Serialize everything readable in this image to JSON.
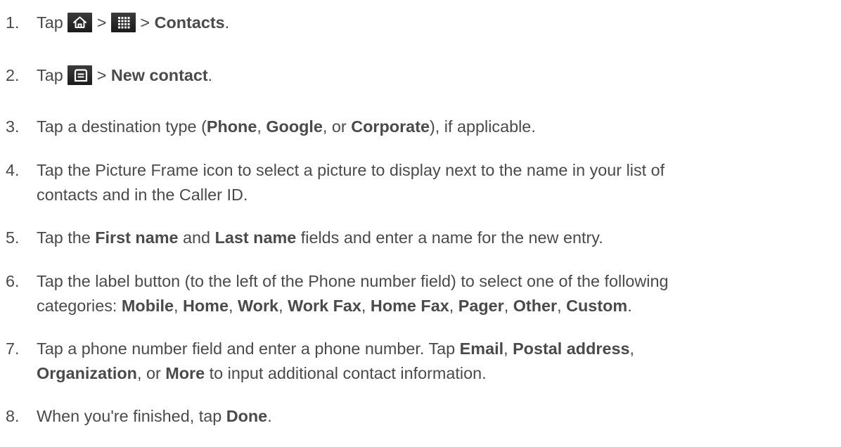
{
  "steps": [
    {
      "number": "1.",
      "parts": [
        {
          "t": "Tap "
        },
        {
          "icon": "home-icon"
        },
        {
          "t": " > "
        },
        {
          "icon": "apps-grid-icon"
        },
        {
          "t": " > "
        },
        {
          "b": "Contacts"
        },
        {
          "t": "."
        }
      ]
    },
    {
      "number": "2.",
      "parts": [
        {
          "t": "Tap "
        },
        {
          "icon": "menu-icon"
        },
        {
          "t": " > "
        },
        {
          "b": "New contact"
        },
        {
          "t": "."
        }
      ]
    },
    {
      "number": "3.",
      "parts": [
        {
          "t": "Tap a destination type ("
        },
        {
          "b": "Phone"
        },
        {
          "t": ", "
        },
        {
          "b": "Google"
        },
        {
          "t": ", or "
        },
        {
          "b": "Corporate"
        },
        {
          "t": "), if applicable."
        }
      ]
    },
    {
      "number": "4.",
      "lines": [
        [
          {
            "t": "Tap the Picture Frame icon to select a picture to display next to the name in your list of"
          }
        ],
        [
          {
            "t": "contacts and in the Caller ID."
          }
        ]
      ]
    },
    {
      "number": "5.",
      "parts": [
        {
          "t": "Tap the "
        },
        {
          "b": "First name"
        },
        {
          "t": " and "
        },
        {
          "b": "Last name"
        },
        {
          "t": " fields and enter a name for the new entry."
        }
      ]
    },
    {
      "number": "6.",
      "lines": [
        [
          {
            "t": "Tap the label button (to the left of the Phone number field) to select one of the following"
          }
        ],
        [
          {
            "t": "categories: "
          },
          {
            "b": "Mobile"
          },
          {
            "t": ", "
          },
          {
            "b": "Home"
          },
          {
            "t": ", "
          },
          {
            "b": "Work"
          },
          {
            "t": ", "
          },
          {
            "b": "Work Fax"
          },
          {
            "t": ", "
          },
          {
            "b": "Home Fax"
          },
          {
            "t": ", "
          },
          {
            "b": "Pager"
          },
          {
            "t": ", "
          },
          {
            "b": "Other"
          },
          {
            "t": ", "
          },
          {
            "b": "Custom"
          },
          {
            "t": "."
          }
        ]
      ]
    },
    {
      "number": "7.",
      "lines": [
        [
          {
            "t": "Tap a phone number field and enter a phone number. Tap "
          },
          {
            "b": "Email"
          },
          {
            "t": ", "
          },
          {
            "b": "Postal address"
          },
          {
            "t": ","
          }
        ],
        [
          {
            "b": "Organization"
          },
          {
            "t": ", or "
          },
          {
            "b": "More"
          },
          {
            "t": " to input additional contact information."
          }
        ]
      ]
    },
    {
      "number": "8.",
      "parts": [
        {
          "t": "When you're finished, tap "
        },
        {
          "b": "Done"
        },
        {
          "t": "."
        }
      ]
    }
  ]
}
